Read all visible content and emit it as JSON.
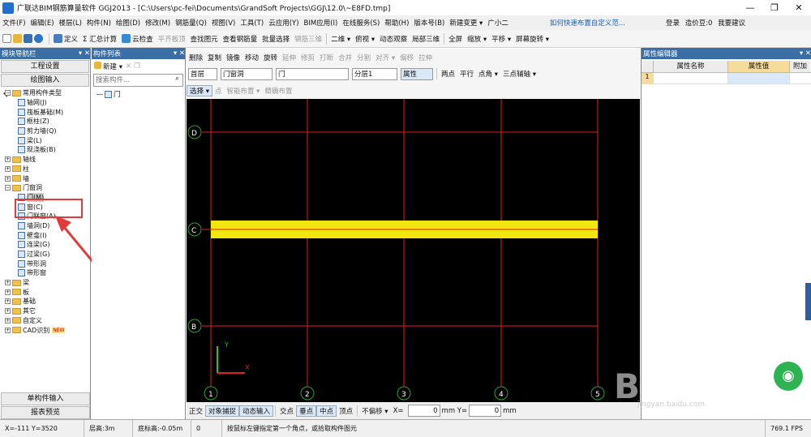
{
  "title": {
    "app": "广联达BIM钢筋算量软件 GGJ2013 - [C:\\Users\\pc-fei\\Documents\\GrandSoft Projects\\GGJ\\12.0\\~E8FD.tmp]",
    "controls": [
      "—",
      "❐",
      "✕"
    ]
  },
  "menu": {
    "items": [
      "文件(F)",
      "编辑(E)",
      "楼层(L)",
      "构件(N)",
      "绘图(D)",
      "修改(M)",
      "钢筋量(Q)",
      "视图(V)",
      "工具(T)",
      "云应用(Y)",
      "BIM应用(I)",
      "在线服务(S)",
      "帮助(H)",
      "版本号(B)",
      "新建变更 ▾",
      "广小二"
    ],
    "hint": "如何快速布置自定义范...",
    "right": [
      "登录",
      "造价豆:0",
      "我要建议"
    ]
  },
  "toolbar1": {
    "items": [
      "定义",
      "Σ 汇总计算",
      "云检查",
      "平齐板顶",
      "查找图元",
      "查看钢筋量",
      "批量选择",
      "钢筋三维",
      "二维 ▾",
      "俯视 ▾",
      "动态观察",
      "局部三维",
      "全屏",
      "缩放 ▾",
      "平移 ▾",
      "屏幕旋转 ▾"
    ]
  },
  "left": {
    "title": "模块导航栏",
    "pin": "▾ ✕",
    "buttons": [
      "工程设置",
      "绘图输入"
    ],
    "bottom_buttons": [
      "单构件输入",
      "报表预览"
    ],
    "tree": [
      {
        "label": "常用构件类型",
        "level": 0,
        "type": "open"
      },
      {
        "label": "轴网(J)",
        "level": 1,
        "type": "leaf"
      },
      {
        "label": "筏板基础(M)",
        "level": 1,
        "type": "leaf"
      },
      {
        "label": "框柱(Z)",
        "level": 1,
        "type": "leaf"
      },
      {
        "label": "剪力墙(Q)",
        "level": 1,
        "type": "leaf"
      },
      {
        "label": "梁(L)",
        "level": 1,
        "type": "leaf"
      },
      {
        "label": "现浇板(B)",
        "level": 1,
        "type": "leaf"
      },
      {
        "label": "轴线",
        "level": 0,
        "type": "closed"
      },
      {
        "label": "柱",
        "level": 0,
        "type": "closed"
      },
      {
        "label": "墙",
        "level": 0,
        "type": "closed"
      },
      {
        "label": "门窗洞",
        "level": 0,
        "type": "open"
      },
      {
        "label": "门(M)",
        "level": 1,
        "type": "leaf"
      },
      {
        "label": "窗(C)",
        "level": 1,
        "type": "leaf"
      },
      {
        "label": "门联窗(A)",
        "level": 1,
        "type": "leaf"
      },
      {
        "label": "墙洞(D)",
        "level": 1,
        "type": "leaf"
      },
      {
        "label": "壁龛(I)",
        "level": 1,
        "type": "leaf"
      },
      {
        "label": "连梁(G)",
        "level": 1,
        "type": "leaf"
      },
      {
        "label": "过梁(G)",
        "level": 1,
        "type": "leaf"
      },
      {
        "label": "带形洞",
        "level": 1,
        "type": "leaf"
      },
      {
        "label": "带形窗",
        "level": 1,
        "type": "leaf"
      },
      {
        "label": "梁",
        "level": 0,
        "type": "closed"
      },
      {
        "label": "板",
        "level": 0,
        "type": "closed"
      },
      {
        "label": "基础",
        "level": 0,
        "type": "closed"
      },
      {
        "label": "其它",
        "level": 0,
        "type": "closed"
      },
      {
        "label": "自定义",
        "level": 0,
        "type": "closed"
      },
      {
        "label": "CAD识别",
        "level": 0,
        "type": "closed",
        "badge": "NEW"
      }
    ]
  },
  "mid": {
    "title": "构件列表",
    "new_label": "新建 ▾",
    "search_placeholder": "搜索构件...",
    "items": [
      "门"
    ]
  },
  "edit": {
    "items": [
      "删除",
      "复制",
      "镜像",
      "移动",
      "旋转",
      "延伸",
      "修剪",
      "打断",
      "合并",
      "分割",
      "对齐 ▾",
      "偏移",
      "拉伸"
    ]
  },
  "selectors": {
    "floor": "首层",
    "category": "门窗洞",
    "type": "门",
    "layer": "分层1",
    "props": "属性"
  },
  "draw": {
    "items": [
      "两点",
      "平行",
      "点角 ▾",
      "三点辅轴 ▾"
    ]
  },
  "draw2": {
    "items": [
      "选择 ▾",
      "点",
      "智能布置 ▾",
      "精确布置"
    ]
  },
  "canvas": {
    "rows": [
      "D",
      "C",
      "B"
    ],
    "cols": [
      "1",
      "2",
      "3",
      "4",
      "5"
    ],
    "axis_y": "Y",
    "axis_x": "X"
  },
  "right": {
    "title": "属性编辑器",
    "headers": [
      "属性名称",
      "属性值",
      "附加"
    ],
    "row1": "1"
  },
  "snap": {
    "items": [
      "正交",
      "对象捕捉",
      "动态输入",
      "交点",
      "垂点",
      "中点",
      "顶点",
      "不偏移 ▾",
      "X=",
      "0",
      "mm Y=",
      "0",
      "mm"
    ]
  },
  "status": {
    "coords": "X=-111 Y=3520",
    "floor_h": "层高:3m",
    "bottom_h": "底标高:-0.05m",
    "zero": "0",
    "hint": "按鼠标左键指定第一个角点，或拾取构件图元",
    "fps": "769.1 FPS"
  },
  "watermark": {
    "main": "Bai 经验",
    "sub": "jingyan.baidu.com"
  },
  "colors": {
    "beam": "#f2e60f",
    "grid": "#e02020",
    "canvas": "#000000",
    "panel_title": "#3a6ea5",
    "annotation": "#e23a3a"
  }
}
